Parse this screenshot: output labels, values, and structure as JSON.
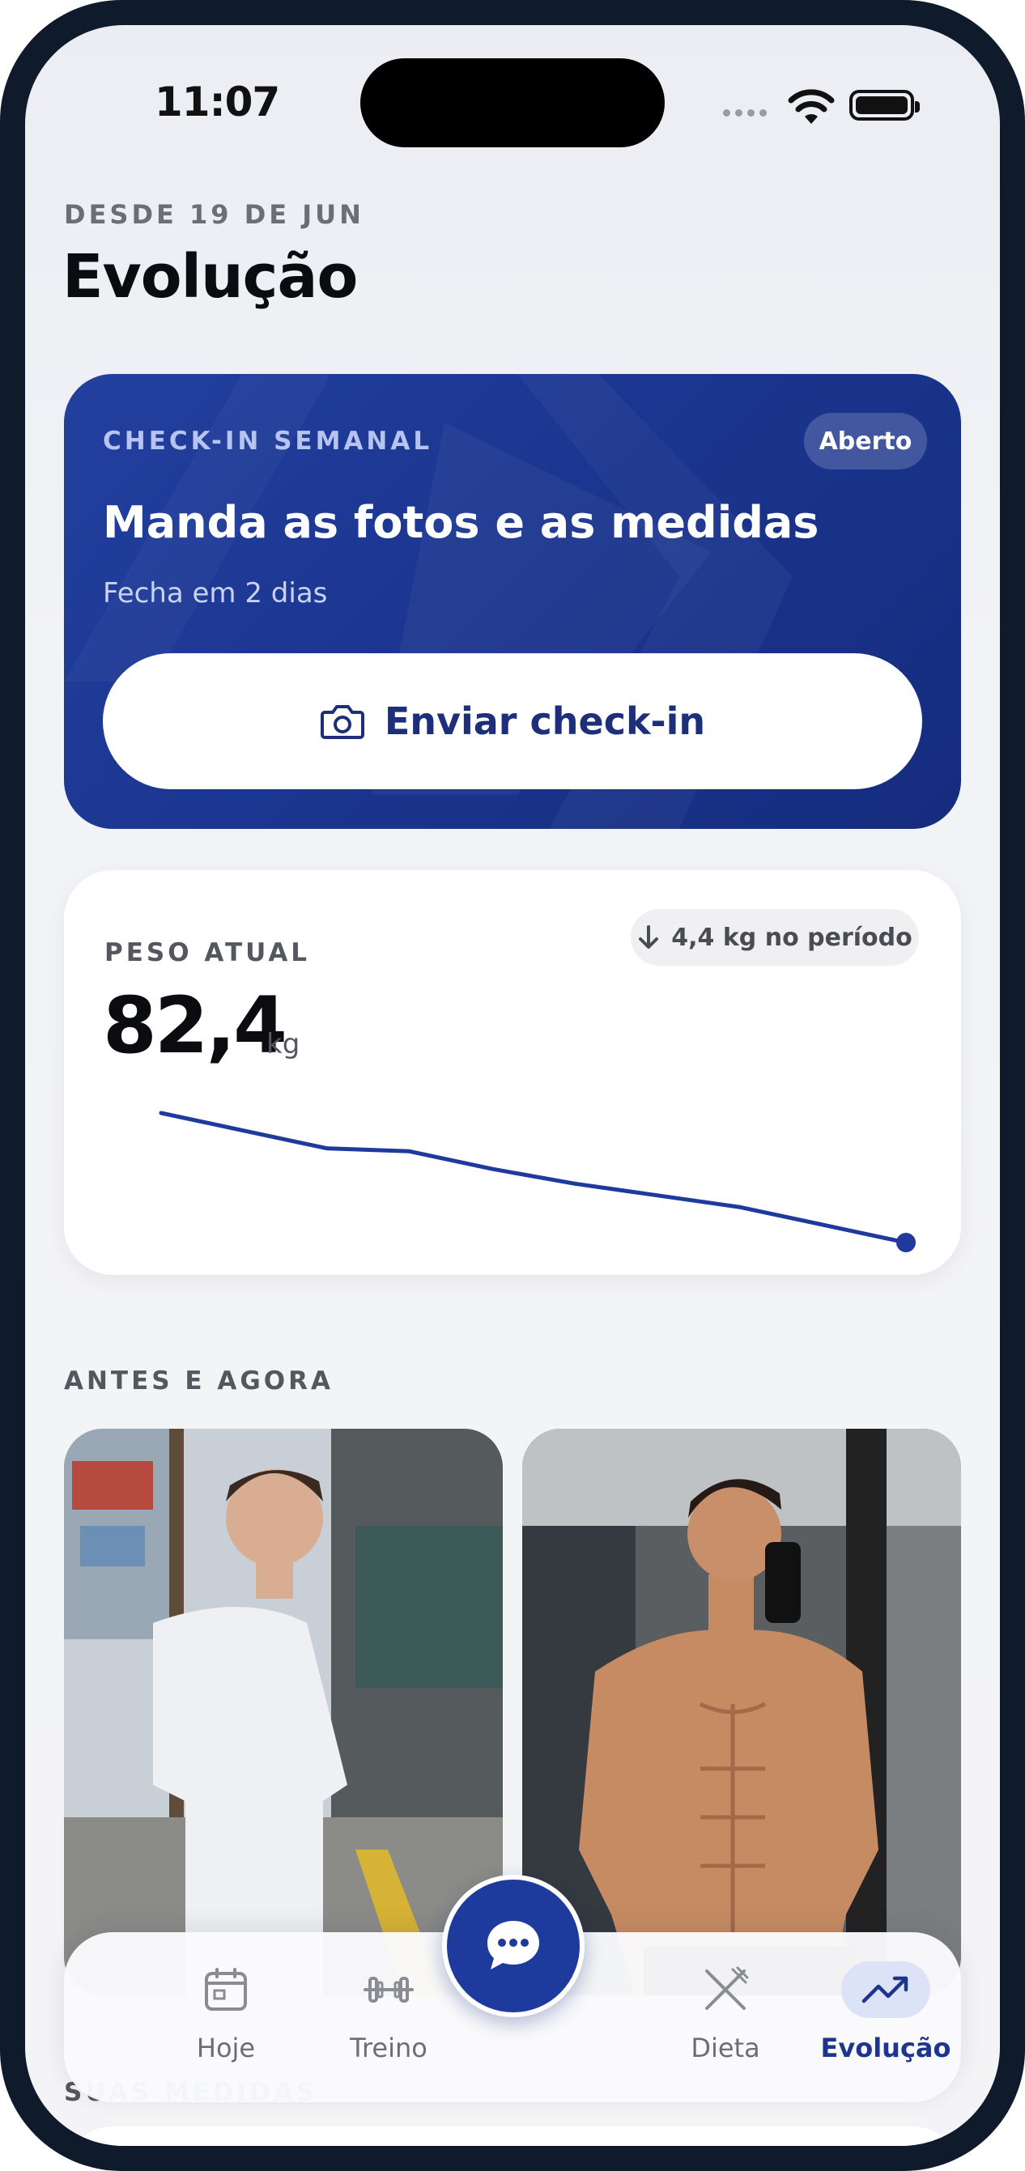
{
  "status_bar": {
    "time": "11:07"
  },
  "header": {
    "eyebrow": "DESDE 19 DE JUN",
    "title": "Evolução"
  },
  "checkin": {
    "eyebrow": "CHECK-IN SEMANAL",
    "badge": "Aberto",
    "title": "Manda as fotos e as medidas",
    "subtitle": "Fecha em 2 dias",
    "button_label": "Enviar check-in",
    "button_icon": "camera-icon"
  },
  "weight": {
    "eyebrow": "PESO ATUAL",
    "value": "82,4",
    "unit": "kg",
    "delta_label": "4,4 kg no período",
    "delta_icon": "arrow-down-icon"
  },
  "chart_data": {
    "type": "line",
    "series": [
      {
        "values": [
          86.8,
          86.2,
          85.6,
          85.5,
          84.9,
          84.4,
          84.0,
          83.6,
          83.0
        ]
      }
    ],
    "ylim": [
      82.4,
      86.8
    ],
    "grid": false,
    "legend": "none",
    "color": "#1e3a9c"
  },
  "before_after": {
    "label": "ANTES E AGORA"
  },
  "measures": {
    "label": "SUAS MEDIDAS"
  },
  "nav": {
    "items": [
      {
        "label": "Hoje",
        "icon": "calendar-icon"
      },
      {
        "label": "Treino",
        "icon": "dumbbell-icon"
      },
      {
        "label": "Dieta",
        "icon": "fork-knife-icon"
      },
      {
        "label": "Evolução",
        "icon": "trending-up-icon",
        "active": true
      }
    ],
    "fab_icon": "chat-bubble-icon"
  },
  "colors": {
    "brand": "#1e3a9c",
    "background": "#f2f3f6",
    "text": "#0b0c10"
  }
}
